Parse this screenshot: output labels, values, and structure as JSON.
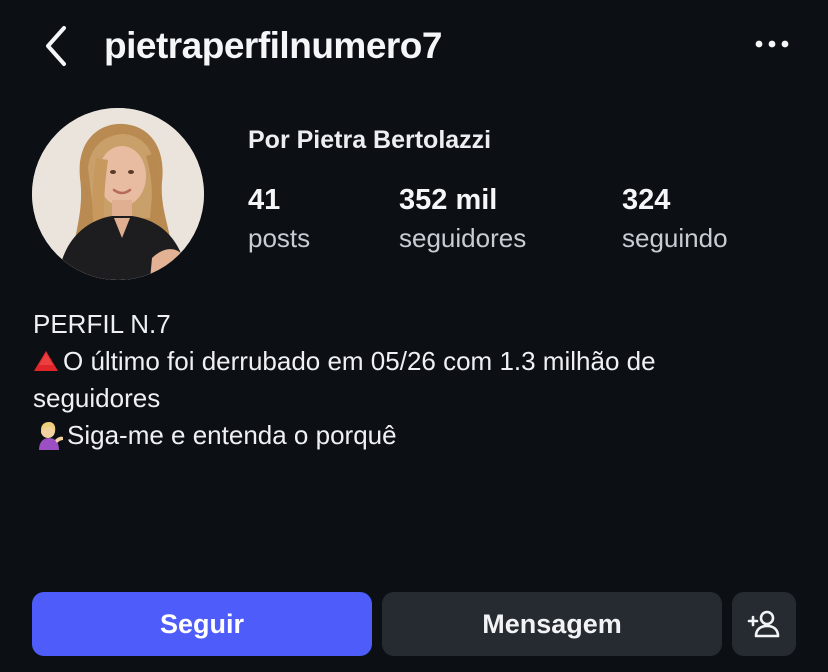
{
  "header": {
    "username": "pietraperfilnumero7",
    "back_icon": "chevron-left-icon",
    "more_icon": "more-horizontal-icon"
  },
  "profile": {
    "display_name": "Por Pietra Bertolazzi",
    "stats": [
      {
        "value": "41",
        "label": "posts"
      },
      {
        "value": "352 mil",
        "label": "seguidores"
      },
      {
        "value": "324",
        "label": "seguindo"
      }
    ]
  },
  "bio": {
    "line1": "PERFIL N.7",
    "line2": "O último foi derrubado em 05/26 com 1.3 milhão de",
    "line3": "seguidores",
    "line4": "Siga-me e entenda o porquê",
    "line2_icon": "red-triangle-icon",
    "line4_icon": "person-tipping-hand-icon"
  },
  "actions": {
    "follow_label": "Seguir",
    "message_label": "Mensagem",
    "add_user_icon": "add-user-icon"
  },
  "colors": {
    "background": "#0c1015",
    "follow_button": "#4e5cf9",
    "secondary_button": "#262a31"
  }
}
